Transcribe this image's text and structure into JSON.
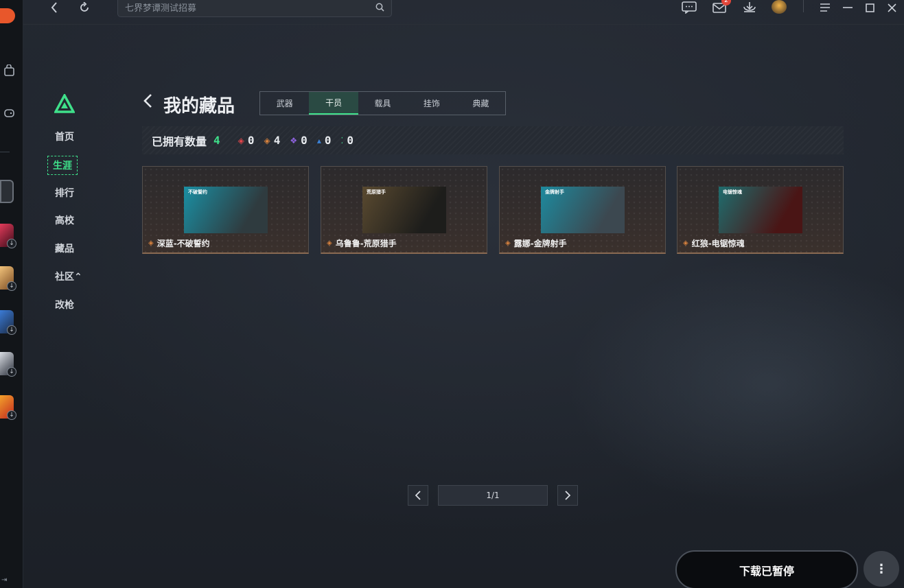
{
  "titlebar": {
    "search_placeholder": "七界梦谭测试招募",
    "mail_badge": "2"
  },
  "nav": {
    "items": [
      {
        "label": "首页"
      },
      {
        "label": "生涯"
      },
      {
        "label": "排行"
      },
      {
        "label": "高校"
      },
      {
        "label": "藏品"
      },
      {
        "label": "社区⌃"
      },
      {
        "label": "改枪"
      }
    ]
  },
  "header": {
    "title": "我的藏品",
    "tabs": [
      {
        "label": "武器"
      },
      {
        "label": "干员"
      },
      {
        "label": "载具"
      },
      {
        "label": "挂饰"
      },
      {
        "label": "典藏"
      }
    ],
    "active_tab": "干员"
  },
  "owned": {
    "label": "已拥有数量",
    "total": "4",
    "stats": [
      {
        "value": "0",
        "color": "#e0454a"
      },
      {
        "value": "4",
        "color": "#d9833e"
      },
      {
        "value": "0",
        "color": "#8f63e0"
      },
      {
        "value": "0",
        "color": "#3b82d6"
      },
      {
        "value": "0",
        "color": "#3fd08a"
      }
    ]
  },
  "cards": [
    {
      "name": "深蓝-不破誓约",
      "tag": "不破誓约",
      "bg": [
        "#1a8fa3",
        "#2f3b3f"
      ]
    },
    {
      "name": "乌鲁鲁-荒原猎手",
      "tag": "荒原猎手",
      "bg": [
        "#5a4a30",
        "#1d1d1b"
      ]
    },
    {
      "name": "露娜-金牌射手",
      "tag": "金牌射手",
      "bg": [
        "#1d8a9e",
        "#3c4850"
      ]
    },
    {
      "name": "红狼-电锯惊魂",
      "tag": "电锯惊魂",
      "bg": [
        "#1f6d6e",
        "#4a1515"
      ]
    }
  ],
  "pagination": {
    "indicator": "1/1"
  },
  "footer": {
    "download_label": "下载已暂停"
  }
}
